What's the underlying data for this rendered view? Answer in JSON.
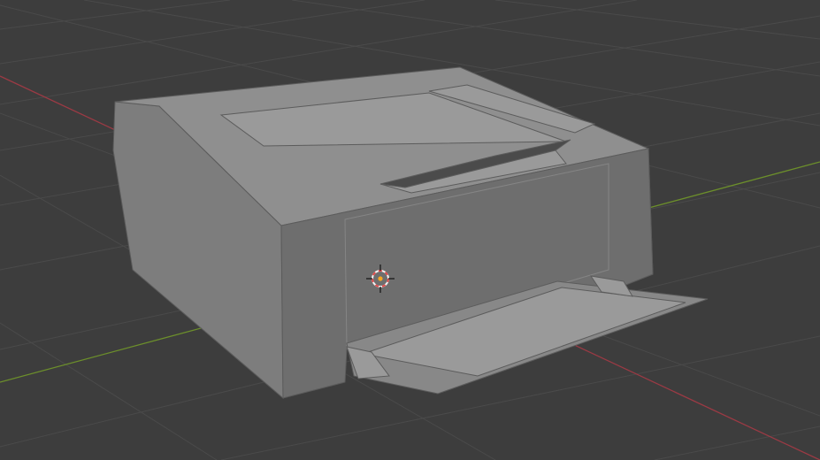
{
  "viewport": {
    "background_color": "#3d3d3d",
    "grid_line_color": "#4a4a4a",
    "x_axis_color": "#9b3a44",
    "y_axis_color": "#6c8f2b"
  },
  "model": {
    "kind": "printer",
    "colors": {
      "left_side": "#7d7d7d",
      "front_panel": "#6e6e6e",
      "top": "#8f8f8f",
      "top_light": "#9a9a9a",
      "tray": "#888888",
      "slot_dark": "#4b4b4b",
      "edge": "#5c5c5c"
    }
  },
  "cursor_3d": {
    "icon": "3d-cursor-icon",
    "ring_red": "#e04a4a",
    "ring_white": "#f2f2f2",
    "crosshair": "#111111"
  },
  "object_origin": {
    "color": "#f5a623"
  }
}
